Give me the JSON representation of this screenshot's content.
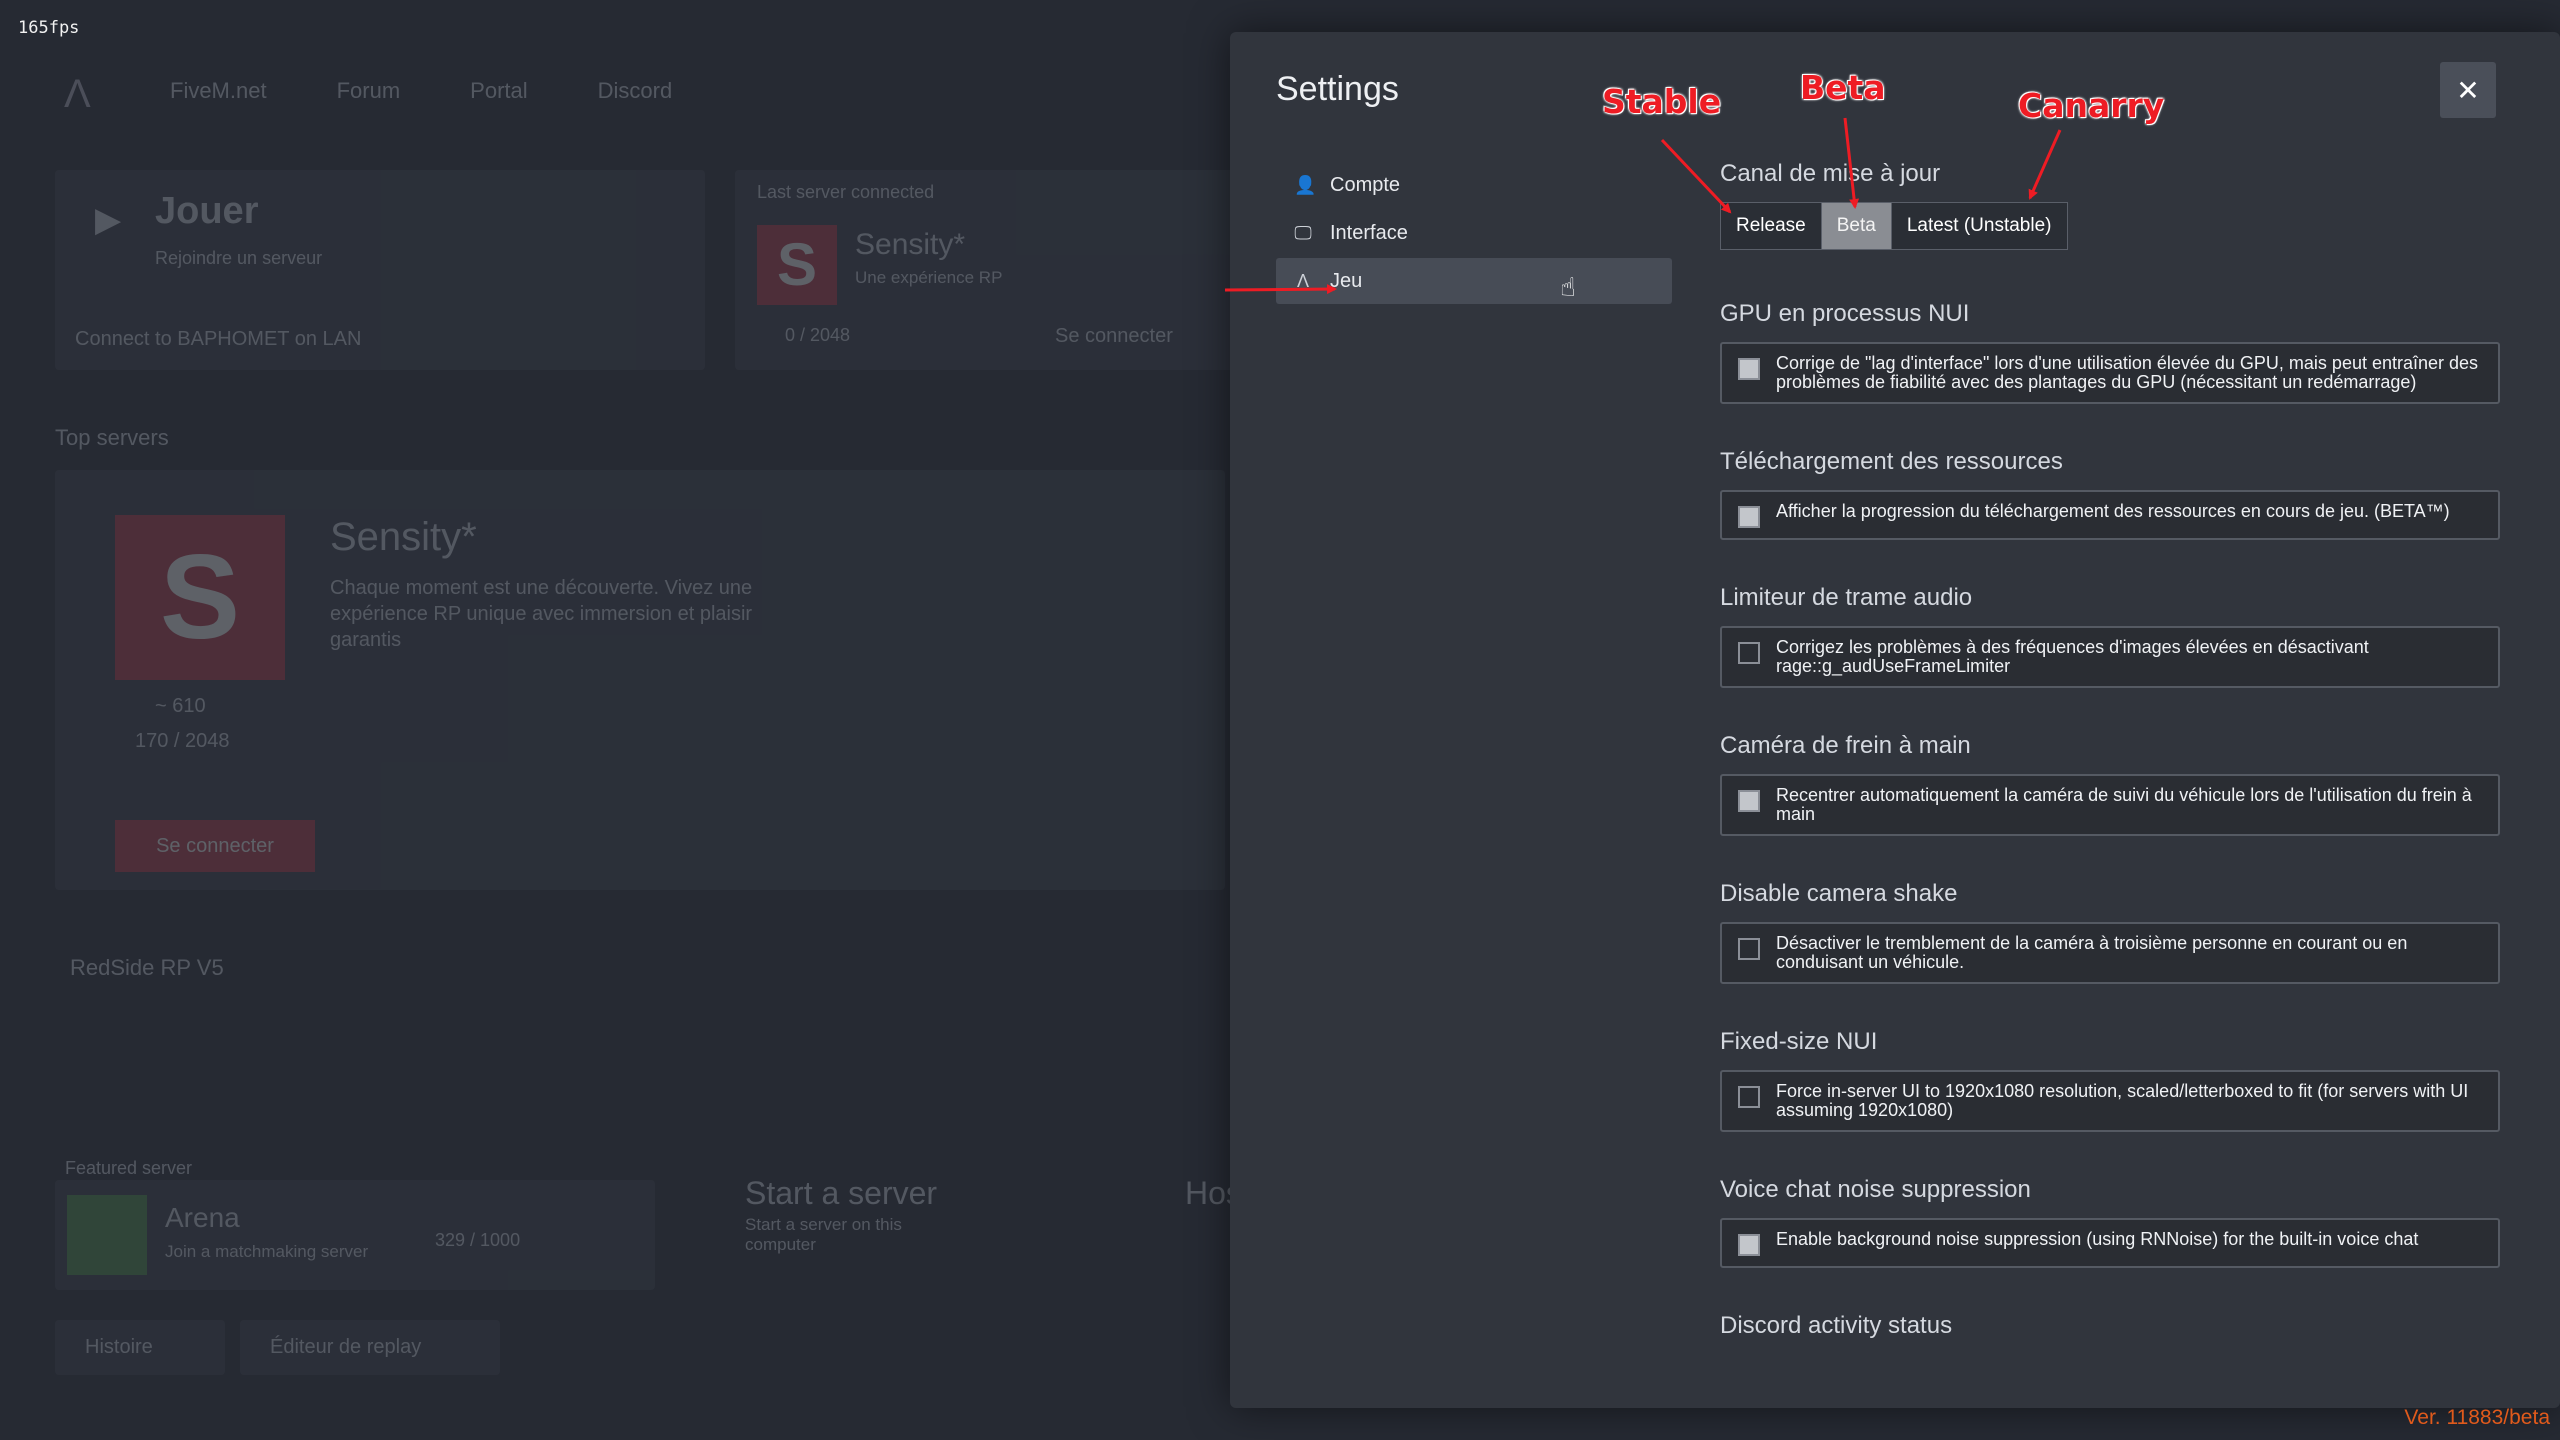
{
  "fps": "165fps",
  "background": {
    "nav": [
      "FiveM.net",
      "Forum",
      "Portal",
      "Discord"
    ],
    "play": {
      "title": "Jouer",
      "sub": "Rejoindre un serveur",
      "lan": "Connect to BAPHOMET on LAN"
    },
    "last": {
      "label": "Last server connected",
      "logo": "S",
      "name": "Sensity*",
      "desc": "Une expérience RP",
      "count": "0 / 2048",
      "connect": "Se connecter"
    },
    "top": {
      "label": "Top servers",
      "logo": "S",
      "name": "Sensity*",
      "desc": "Chaque moment est une découverte. Vivez une expérience RP unique avec immersion et plaisir garantis",
      "stat1": "~ 610",
      "stat2": "170 / 2048",
      "connect": "Se connecter"
    },
    "row": "RedSide RP V5",
    "featured": "Featured server",
    "arena": {
      "name": "Arena",
      "sub": "Join a matchmaking server",
      "count": "329 / 1000"
    },
    "start": {
      "title": "Start a server",
      "sub": "Start a server on this computer"
    },
    "host": {
      "title": "Host"
    },
    "buttons": {
      "history": "Histoire",
      "replay": "Éditeur de replay"
    }
  },
  "modal": {
    "title": "Settings",
    "close_icon": "close-icon",
    "sidebar": [
      {
        "label": "Compte",
        "icon": "user-icon",
        "glyph": "👤",
        "active": false
      },
      {
        "label": "Interface",
        "icon": "monitor-icon",
        "glyph": "🖵",
        "active": false
      },
      {
        "label": "Jeu",
        "icon": "fivem-logo-icon",
        "glyph": "Λ",
        "active": true
      }
    ],
    "update_channel": {
      "title": "Canal de mise à jour",
      "options": [
        "Release",
        "Beta",
        "Latest (Unstable)"
      ],
      "selected": "Beta"
    },
    "settings": [
      {
        "title": "GPU en processus NUI",
        "text": "Corrige de \"lag d'interface\" lors d'une utilisation élevée du GPU, mais peut entraîner des problèmes de fiabilité avec des plantages du GPU (nécessitant un redémarrage)",
        "checked": true
      },
      {
        "title": "Téléchargement des ressources",
        "text": "Afficher la progression du téléchargement des ressources en cours de jeu. (BETA™)",
        "checked": true
      },
      {
        "title": "Limiteur de trame audio",
        "text": "Corrigez les problèmes à des fréquences d'images élevées en désactivant rage::g_audUseFrameLimiter",
        "checked": false
      },
      {
        "title": "Caméra de frein à main",
        "text": "Recentrer automatiquement la caméra de suivi du véhicule lors de l'utilisation du frein à main",
        "checked": true
      },
      {
        "title": "Disable camera shake",
        "text": "Désactiver le tremblement de la caméra à troisième personne en courant ou en conduisant un véhicule.",
        "checked": false
      },
      {
        "title": "Fixed-size NUI",
        "text": "Force in-server UI to 1920x1080 resolution, scaled/letterboxed to fit (for servers with UI assuming 1920x1080)",
        "checked": false
      },
      {
        "title": "Voice chat noise suppression",
        "text": "Enable background noise suppression (using RNNoise) for the built-in voice chat",
        "checked": true
      },
      {
        "title": "Discord activity status",
        "text": "",
        "checked": false
      }
    ]
  },
  "annotations": {
    "stable": "Stable",
    "beta": "Beta",
    "canary": "Canarry"
  },
  "version": "Ver. 11883/beta",
  "colors": {
    "annotation": "#ee1c24",
    "version": "#e05a1c",
    "accent": "#b13a4a"
  }
}
